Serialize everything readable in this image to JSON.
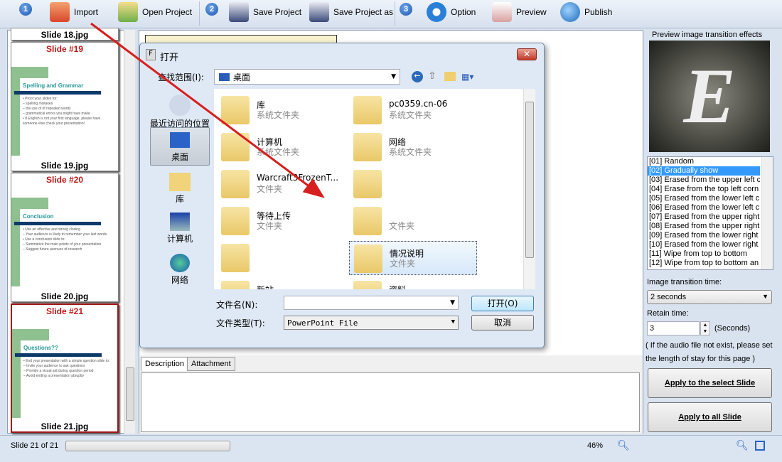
{
  "toolbar": {
    "step1": "1",
    "import": "Import",
    "open_project": "Open Project",
    "step2": "2",
    "save_project": "Save Project",
    "save_project_as": "Save Project as",
    "step3": "3",
    "option": "Option",
    "preview": "Preview",
    "publish": "Publish"
  },
  "slides": [
    {
      "title": "",
      "file": "Slide 18.jpg"
    },
    {
      "title": "Slide #19",
      "file": "Slide 19.jpg",
      "heading": "Spelling and Grammar",
      "lines": [
        "• Proof your slides for:",
        "  – spelling mistakes",
        "  – the use of of repeated words",
        "  – grammatical errors you might have make",
        "• If English is not your first language, please have someone else check your presentation!"
      ]
    },
    {
      "title": "Slide #20",
      "file": "Slide 20.jpg",
      "heading": "Conclusion",
      "lines": [
        "• Use an effective and strong closing",
        "  – Your audience is likely to remember your last words",
        "• Use a conclusion slide to:",
        "  – Summarize the main points of your presentation",
        "  – Suggest future avenues of research"
      ]
    },
    {
      "title": "Slide #21",
      "file": "Slide 21.jpg",
      "heading": "Questions??",
      "lines": [
        "• End your presentation with a simple question slide to:",
        "  – Invite your audience to ask questions",
        "  – Provide a visual aid during question period",
        "  – Avoid ending a presentation abruptly"
      ]
    }
  ],
  "dialog": {
    "title": "打开",
    "look_in_label": "查找范围(I):",
    "look_in_value": "桌面",
    "places": [
      "最近访问的位置",
      "桌面",
      "库",
      "计算机",
      "网络"
    ],
    "items": [
      {
        "name": "库",
        "type": "系统文件夹"
      },
      {
        "name": "pc0359.cn-06",
        "type": "系统文件夹"
      },
      {
        "name": "计算机",
        "type": "系统文件夹"
      },
      {
        "name": "网络",
        "type": "系统文件夹"
      },
      {
        "name": "Warcraft3FrozenT...",
        "type": "文件夹"
      },
      {
        "name": "",
        "type": ""
      },
      {
        "name": "等待上传",
        "type": "文件夹"
      },
      {
        "name": "",
        "type": "文件夹"
      },
      {
        "name": "",
        "type": ""
      },
      {
        "name": "情况说明",
        "type": "文件夹"
      },
      {
        "name": "新站",
        "type": ""
      },
      {
        "name": "资料",
        "type": ""
      }
    ],
    "filename_label": "文件名(N):",
    "filename_value": "",
    "filetype_label": "文件类型(T):",
    "filetype_value": "PowerPoint File",
    "open": "打开(O)",
    "cancel": "取消"
  },
  "description": {
    "tabs": [
      "Description",
      "Attachment"
    ]
  },
  "right": {
    "preview_label": "Preview image transition effects",
    "preview_letter": "E",
    "effects": [
      "[01] Random",
      "[02] Gradually show",
      "[03] Erased from the upper left c",
      "[04] Erase from the top left corn",
      "[05] Erased from the lower left c",
      "[06] Erased from the lower left c",
      "[07] Erased from the upper right",
      "[08] Erased from the upper right",
      "[09] Erased from the lower right",
      "[10] Erased from the lower right",
      "[11] Wipe from top to bottom",
      "[12] Wipe from top to bottom an"
    ],
    "selected_effect": 1,
    "transition_label": "Image transition time:",
    "transition_value": "2 seconds",
    "retain_label": "Retain time:",
    "retain_value": "3",
    "retain_unit": "(Seconds)",
    "note": "( If the audio file not exist, please set the length of stay for this page )",
    "apply_selected": "Apply to the select Slide",
    "apply_all": "Apply to all Slide"
  },
  "status": {
    "slide": "Slide 21 of 21",
    "zoom": "46%"
  }
}
